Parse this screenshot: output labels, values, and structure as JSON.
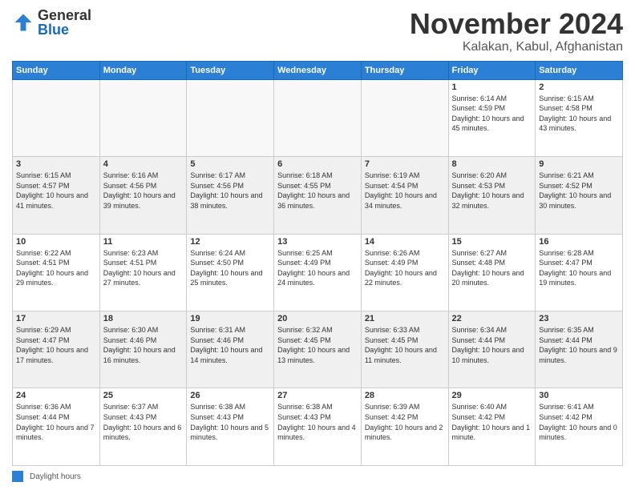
{
  "logo": {
    "general": "General",
    "blue": "Blue"
  },
  "title": "November 2024",
  "location": "Kalakan, Kabul, Afghanistan",
  "days_of_week": [
    "Sunday",
    "Monday",
    "Tuesday",
    "Wednesday",
    "Thursday",
    "Friday",
    "Saturday"
  ],
  "footer_legend": "Daylight hours",
  "weeks": [
    [
      {
        "day": "",
        "sunrise": "",
        "sunset": "",
        "daylight": "",
        "empty": true
      },
      {
        "day": "",
        "sunrise": "",
        "sunset": "",
        "daylight": "",
        "empty": true
      },
      {
        "day": "",
        "sunrise": "",
        "sunset": "",
        "daylight": "",
        "empty": true
      },
      {
        "day": "",
        "sunrise": "",
        "sunset": "",
        "daylight": "",
        "empty": true
      },
      {
        "day": "",
        "sunrise": "",
        "sunset": "",
        "daylight": "",
        "empty": true
      },
      {
        "day": "1",
        "sunrise": "Sunrise: 6:14 AM",
        "sunset": "Sunset: 4:59 PM",
        "daylight": "Daylight: 10 hours and 45 minutes.",
        "empty": false
      },
      {
        "day": "2",
        "sunrise": "Sunrise: 6:15 AM",
        "sunset": "Sunset: 4:58 PM",
        "daylight": "Daylight: 10 hours and 43 minutes.",
        "empty": false
      }
    ],
    [
      {
        "day": "3",
        "sunrise": "Sunrise: 6:15 AM",
        "sunset": "Sunset: 4:57 PM",
        "daylight": "Daylight: 10 hours and 41 minutes.",
        "empty": false
      },
      {
        "day": "4",
        "sunrise": "Sunrise: 6:16 AM",
        "sunset": "Sunset: 4:56 PM",
        "daylight": "Daylight: 10 hours and 39 minutes.",
        "empty": false
      },
      {
        "day": "5",
        "sunrise": "Sunrise: 6:17 AM",
        "sunset": "Sunset: 4:56 PM",
        "daylight": "Daylight: 10 hours and 38 minutes.",
        "empty": false
      },
      {
        "day": "6",
        "sunrise": "Sunrise: 6:18 AM",
        "sunset": "Sunset: 4:55 PM",
        "daylight": "Daylight: 10 hours and 36 minutes.",
        "empty": false
      },
      {
        "day": "7",
        "sunrise": "Sunrise: 6:19 AM",
        "sunset": "Sunset: 4:54 PM",
        "daylight": "Daylight: 10 hours and 34 minutes.",
        "empty": false
      },
      {
        "day": "8",
        "sunrise": "Sunrise: 6:20 AM",
        "sunset": "Sunset: 4:53 PM",
        "daylight": "Daylight: 10 hours and 32 minutes.",
        "empty": false
      },
      {
        "day": "9",
        "sunrise": "Sunrise: 6:21 AM",
        "sunset": "Sunset: 4:52 PM",
        "daylight": "Daylight: 10 hours and 30 minutes.",
        "empty": false
      }
    ],
    [
      {
        "day": "10",
        "sunrise": "Sunrise: 6:22 AM",
        "sunset": "Sunset: 4:51 PM",
        "daylight": "Daylight: 10 hours and 29 minutes.",
        "empty": false
      },
      {
        "day": "11",
        "sunrise": "Sunrise: 6:23 AM",
        "sunset": "Sunset: 4:51 PM",
        "daylight": "Daylight: 10 hours and 27 minutes.",
        "empty": false
      },
      {
        "day": "12",
        "sunrise": "Sunrise: 6:24 AM",
        "sunset": "Sunset: 4:50 PM",
        "daylight": "Daylight: 10 hours and 25 minutes.",
        "empty": false
      },
      {
        "day": "13",
        "sunrise": "Sunrise: 6:25 AM",
        "sunset": "Sunset: 4:49 PM",
        "daylight": "Daylight: 10 hours and 24 minutes.",
        "empty": false
      },
      {
        "day": "14",
        "sunrise": "Sunrise: 6:26 AM",
        "sunset": "Sunset: 4:49 PM",
        "daylight": "Daylight: 10 hours and 22 minutes.",
        "empty": false
      },
      {
        "day": "15",
        "sunrise": "Sunrise: 6:27 AM",
        "sunset": "Sunset: 4:48 PM",
        "daylight": "Daylight: 10 hours and 20 minutes.",
        "empty": false
      },
      {
        "day": "16",
        "sunrise": "Sunrise: 6:28 AM",
        "sunset": "Sunset: 4:47 PM",
        "daylight": "Daylight: 10 hours and 19 minutes.",
        "empty": false
      }
    ],
    [
      {
        "day": "17",
        "sunrise": "Sunrise: 6:29 AM",
        "sunset": "Sunset: 4:47 PM",
        "daylight": "Daylight: 10 hours and 17 minutes.",
        "empty": false
      },
      {
        "day": "18",
        "sunrise": "Sunrise: 6:30 AM",
        "sunset": "Sunset: 4:46 PM",
        "daylight": "Daylight: 10 hours and 16 minutes.",
        "empty": false
      },
      {
        "day": "19",
        "sunrise": "Sunrise: 6:31 AM",
        "sunset": "Sunset: 4:46 PM",
        "daylight": "Daylight: 10 hours and 14 minutes.",
        "empty": false
      },
      {
        "day": "20",
        "sunrise": "Sunrise: 6:32 AM",
        "sunset": "Sunset: 4:45 PM",
        "daylight": "Daylight: 10 hours and 13 minutes.",
        "empty": false
      },
      {
        "day": "21",
        "sunrise": "Sunrise: 6:33 AM",
        "sunset": "Sunset: 4:45 PM",
        "daylight": "Daylight: 10 hours and 11 minutes.",
        "empty": false
      },
      {
        "day": "22",
        "sunrise": "Sunrise: 6:34 AM",
        "sunset": "Sunset: 4:44 PM",
        "daylight": "Daylight: 10 hours and 10 minutes.",
        "empty": false
      },
      {
        "day": "23",
        "sunrise": "Sunrise: 6:35 AM",
        "sunset": "Sunset: 4:44 PM",
        "daylight": "Daylight: 10 hours and 9 minutes.",
        "empty": false
      }
    ],
    [
      {
        "day": "24",
        "sunrise": "Sunrise: 6:36 AM",
        "sunset": "Sunset: 4:44 PM",
        "daylight": "Daylight: 10 hours and 7 minutes.",
        "empty": false
      },
      {
        "day": "25",
        "sunrise": "Sunrise: 6:37 AM",
        "sunset": "Sunset: 4:43 PM",
        "daylight": "Daylight: 10 hours and 6 minutes.",
        "empty": false
      },
      {
        "day": "26",
        "sunrise": "Sunrise: 6:38 AM",
        "sunset": "Sunset: 4:43 PM",
        "daylight": "Daylight: 10 hours and 5 minutes.",
        "empty": false
      },
      {
        "day": "27",
        "sunrise": "Sunrise: 6:38 AM",
        "sunset": "Sunset: 4:43 PM",
        "daylight": "Daylight: 10 hours and 4 minutes.",
        "empty": false
      },
      {
        "day": "28",
        "sunrise": "Sunrise: 6:39 AM",
        "sunset": "Sunset: 4:42 PM",
        "daylight": "Daylight: 10 hours and 2 minutes.",
        "empty": false
      },
      {
        "day": "29",
        "sunrise": "Sunrise: 6:40 AM",
        "sunset": "Sunset: 4:42 PM",
        "daylight": "Daylight: 10 hours and 1 minute.",
        "empty": false
      },
      {
        "day": "30",
        "sunrise": "Sunrise: 6:41 AM",
        "sunset": "Sunset: 4:42 PM",
        "daylight": "Daylight: 10 hours and 0 minutes.",
        "empty": false
      }
    ]
  ]
}
